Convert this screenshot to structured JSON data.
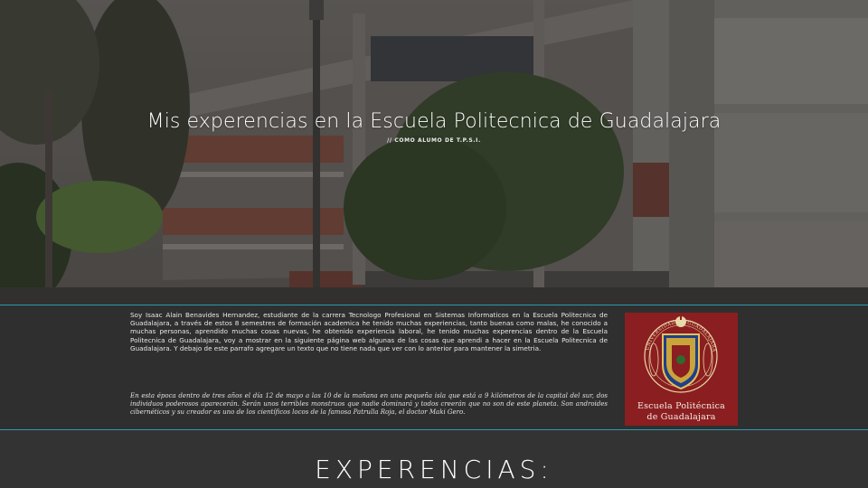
{
  "hero": {
    "title": "Mis experencias en la Escuela Politecnica de Guadalajara",
    "subtitle": "// COMO ALUMO DE T.P.S.I."
  },
  "about": {
    "paragraph_1": "Soy Isaac Alain Benavides Hernandez, estudiante de la carrera Tecnologo Profesional en Sistemas Informaticos en la Escuela Politecnica de Guadalajara, a través de estos 8 semestres de formación academica he tenido muchas experiencias, tanto buenas como malas, he conocido a muchas personas, aprendido muchas cosas nuevas, he obtenido experiencia laboral, he tenido muchas experencias dentro de la Escuela Politecnica de Guadalajara, voy a mostrar en la siguiente página web algunas de las cosas que aprendi a hacer en la Escuela Politecnica de Guadalajara. Y debajo de este parrafo agregare un texto que no tiene nada que ver con lo anterior para mantener la simetria.",
    "paragraph_2": "En esta época dentro de tres años el día 12 de mayo a las 10 de la mañana en una pequeña isla que está a 9 kilómetros de la capital del sur, dos individuos poderosos aparecerán. Serán unos terribles monstruos que nadie dominará y todos creerán que no son de este planeta. Son androides cibernéticos y su creador es uno de los científicos locos de la famosa Patrulla Roja, el doctor Maki Gero.",
    "logo": {
      "seal_text": "UNIVERSIDAD DE GUADALAJARA",
      "line_1": "Escuela Politécnica",
      "line_2": "de Guadalajara",
      "background": "#8b1e20"
    }
  },
  "experiences": {
    "heading": "EXPERENCIAS:"
  },
  "colors": {
    "accent_line": "#2a9bb0",
    "band_background": "#2f2f2f"
  }
}
